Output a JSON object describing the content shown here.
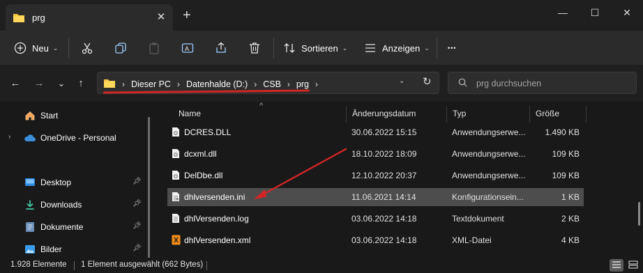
{
  "window": {
    "tab_title": "prg",
    "tab_close": "✕",
    "new_tab": "+",
    "minimize": "—",
    "maximize": "☐",
    "close": "✕"
  },
  "toolbar": {
    "new_label": "Neu",
    "sort_label": "Sortieren",
    "view_label": "Anzeigen",
    "more": "•••"
  },
  "nav": {
    "back": "←",
    "forward": "→",
    "recent": "⌄",
    "up": "↑"
  },
  "address": {
    "crumbs": [
      "Dieser PC",
      "Datenhalde (D:)",
      "CSB",
      "prg"
    ],
    "separator": "›",
    "dropdown": "⌄",
    "refresh": "↻"
  },
  "search": {
    "placeholder": "prg durchsuchen"
  },
  "sidebar": {
    "items": [
      {
        "label": "Start"
      },
      {
        "label": "OneDrive - Personal"
      },
      {
        "label": "Desktop"
      },
      {
        "label": "Downloads"
      },
      {
        "label": "Dokumente"
      },
      {
        "label": "Bilder"
      }
    ]
  },
  "columns": {
    "name": "Name",
    "date": "Änderungsdatum",
    "type": "Typ",
    "size": "Größe"
  },
  "files": [
    {
      "name": "DCRES.DLL",
      "date": "30.06.2022 15:15",
      "type": "Anwendungserwe...",
      "size": "1.490 KB",
      "icon": "dll-icon"
    },
    {
      "name": "dcxml.dll",
      "date": "18.10.2022 18:09",
      "type": "Anwendungserwe...",
      "size": "109 KB",
      "icon": "dll-icon"
    },
    {
      "name": "DelDbe.dll",
      "date": "12.10.2022 20:37",
      "type": "Anwendungserwe...",
      "size": "109 KB",
      "icon": "dll-icon"
    },
    {
      "name": "dhlversenden.ini",
      "date": "11.06.2021 14:14",
      "type": "Konfigurationsein...",
      "size": "1 KB",
      "icon": "ini-icon",
      "selected": true
    },
    {
      "name": "dhlVersenden.log",
      "date": "03.06.2022 14:18",
      "type": "Textdokument",
      "size": "2 KB",
      "icon": "text-file-icon"
    },
    {
      "name": "dhlVersenden.xml",
      "date": "03.06.2022 14:18",
      "type": "XML-Datei",
      "size": "4 KB",
      "icon": "xml-icon"
    }
  ],
  "status": {
    "count": "1.928 Elemente",
    "selection": "1 Element ausgewählt (662 Bytes)"
  },
  "colors": {
    "accent_red": "#d32626",
    "folder_yellow": "#f4c542",
    "selection_bg": "#4d4d4d"
  }
}
